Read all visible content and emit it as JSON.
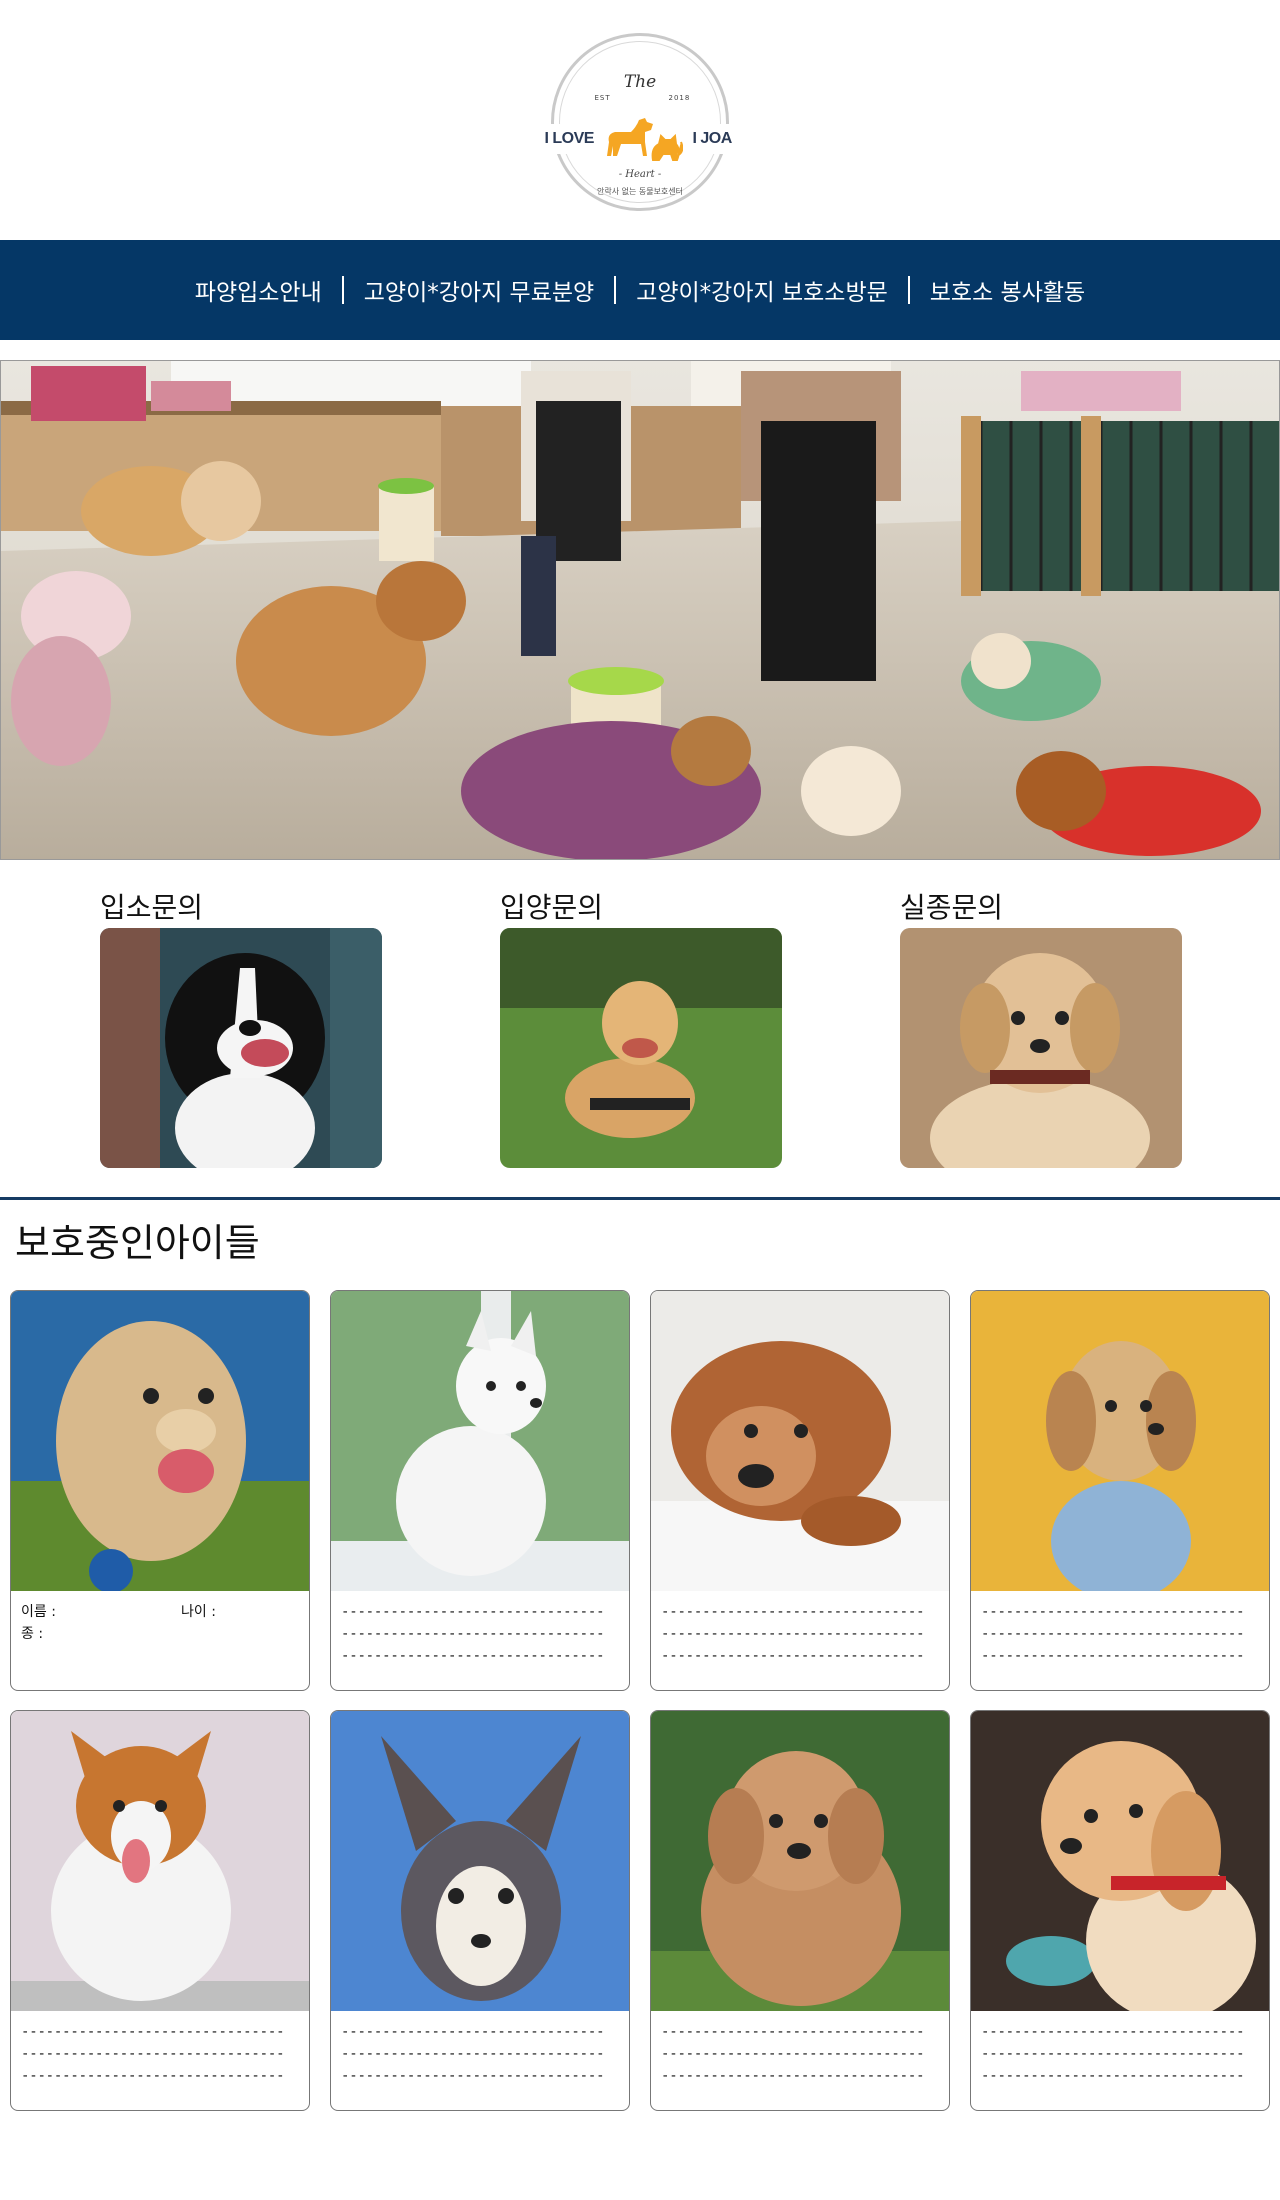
{
  "logo": {
    "the": "The",
    "est": "EST",
    "year": "2018",
    "left_text": "I LOVE",
    "right_text": "I JOA",
    "heart": "- Heart -",
    "sub": "안락사 없는 동물보호센터"
  },
  "nav": {
    "items": [
      {
        "label": "파양입소안내"
      },
      {
        "label": "고양이*강아지 무료분양"
      },
      {
        "label": "고양이*강아지 보호소방문"
      },
      {
        "label": "보호소 봉사활동"
      }
    ]
  },
  "inquiries": [
    {
      "title": "입소문의"
    },
    {
      "title": "입양문의"
    },
    {
      "title": "실종문의"
    }
  ],
  "section": {
    "title": "보호중인아이들"
  },
  "first_card": {
    "name_label": "이름 :",
    "age_label": "나이 :",
    "breed_label": "종 :"
  },
  "placeholder": "--------------------------------",
  "colors": {
    "nav_bg": "#053766",
    "divider": "#153b63",
    "logo_orange": "#f5a623",
    "logo_text": "#2b3b57"
  }
}
